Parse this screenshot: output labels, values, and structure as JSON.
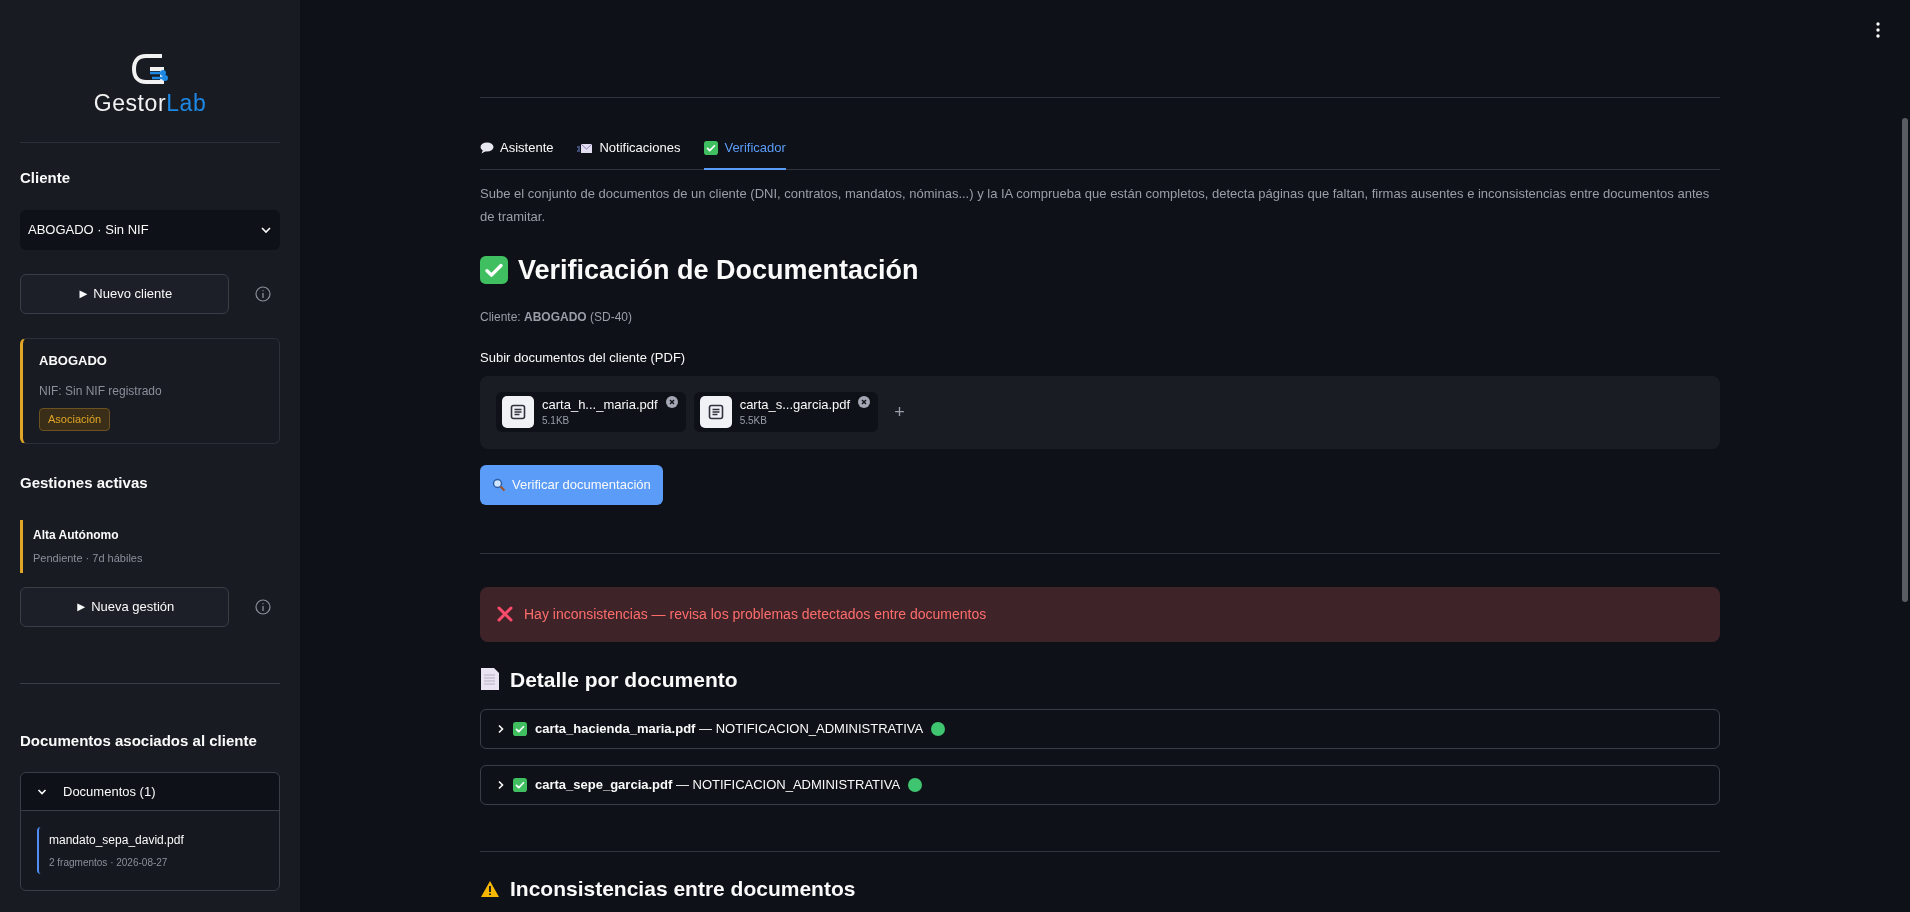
{
  "sidebar": {
    "logo": {
      "primary": "Gestor",
      "accent": "Lab"
    },
    "client": {
      "title": "Cliente",
      "select_value": "ABOGADO · Sin NIF",
      "new_button": "► Nuevo cliente"
    },
    "client_card": {
      "name": "ABOGADO",
      "nif": "NIF: Sin NIF registrado",
      "tag": "Asociación"
    },
    "gestiones": {
      "title": "Gestiones activas",
      "items": [
        {
          "name": "Alta Autónomo",
          "meta": "Pendiente · 7d hábiles",
          "color": "#e0a526"
        }
      ],
      "new_button": "► Nueva gestión"
    },
    "documents": {
      "title": "Documentos asociados al cliente",
      "expander": {
        "label": "Documentos (1)",
        "expanded": true,
        "items": [
          {
            "name": "mandato_sepa_david.pdf",
            "meta": "2 fragmentos · 2026-08-27"
          }
        ]
      }
    }
  },
  "main": {
    "tabs": [
      {
        "label": "Asistente",
        "kind": "chat",
        "selected": false
      },
      {
        "label": "Notificaciones",
        "kind": "mail",
        "selected": false
      },
      {
        "label": "Verificador",
        "kind": "check",
        "selected": true
      }
    ],
    "description": "Sube el conjunto de documentos de un cliente (DNI, contratos, mandatos, nóminas...) y la IA comprueba que están completos, detecta páginas que faltan, firmas ausentes e inconsistencias entre documentos antes de tramitar.",
    "heading": "Verificación de Documentación",
    "client_line": "Cliente: **ABOGADO** (SD-40)",
    "upload": {
      "label": "Subir documentos del cliente (PDF)",
      "files": [
        {
          "name": "carta_h..._maria.pdf",
          "size": "5.1KB"
        },
        {
          "name": "carta_s...garcia.pdf",
          "size": "5.5KB"
        }
      ],
      "add": "+"
    },
    "verify_button": "Verificar documentación",
    "alert": "Hay inconsistencias — revisa los problemas detectados entre documentos",
    "detail": {
      "title": "Detalle por documento",
      "rows": [
        {
          "file": "carta_hacienda_maria.pdf",
          "type": " — NOTIFICACION_ADMINISTRATIVA",
          "expanded": false,
          "color": "#3fc46f"
        },
        {
          "file": "carta_sepe_garcia.pdf",
          "type": " — NOTIFICACION_ADMINISTRATIVA",
          "expanded": false,
          "color": "#3fc46f"
        }
      ]
    },
    "inconsistencies": {
      "title": "Inconsistencias entre documentos"
    }
  }
}
